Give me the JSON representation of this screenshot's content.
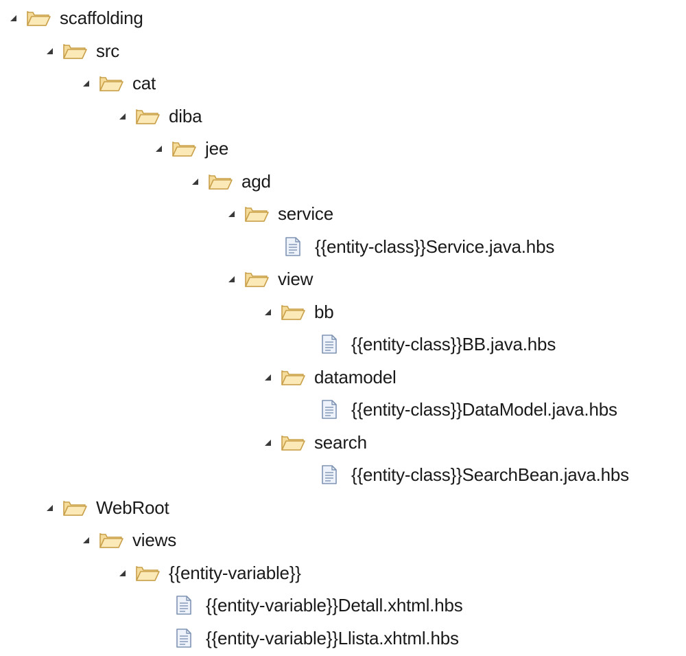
{
  "tree": {
    "nodes": [
      {
        "label": "scaffolding",
        "kind": "folder",
        "expanded": true,
        "depth": 0
      },
      {
        "label": "src",
        "kind": "folder",
        "expanded": true,
        "depth": 1
      },
      {
        "label": "cat",
        "kind": "folder",
        "expanded": true,
        "depth": 2
      },
      {
        "label": "diba",
        "kind": "folder",
        "expanded": true,
        "depth": 3
      },
      {
        "label": "jee",
        "kind": "folder",
        "expanded": true,
        "depth": 4
      },
      {
        "label": "agd",
        "kind": "folder",
        "expanded": true,
        "depth": 5
      },
      {
        "label": "service",
        "kind": "folder",
        "expanded": true,
        "depth": 6
      },
      {
        "label": "{{entity-class}}Service.java.hbs",
        "kind": "file",
        "depth": 7
      },
      {
        "label": "view",
        "kind": "folder",
        "expanded": true,
        "depth": 6
      },
      {
        "label": "bb",
        "kind": "folder",
        "expanded": true,
        "depth": 7
      },
      {
        "label": "{{entity-class}}BB.java.hbs",
        "kind": "file",
        "depth": 8
      },
      {
        "label": "datamodel",
        "kind": "folder",
        "expanded": true,
        "depth": 7
      },
      {
        "label": "{{entity-class}}DataModel.java.hbs",
        "kind": "file",
        "depth": 8
      },
      {
        "label": "search",
        "kind": "folder",
        "expanded": true,
        "depth": 7
      },
      {
        "label": "{{entity-class}}SearchBean.java.hbs",
        "kind": "file",
        "depth": 8
      },
      {
        "label": "WebRoot",
        "kind": "folder",
        "expanded": true,
        "depth": 1
      },
      {
        "label": "views",
        "kind": "folder",
        "expanded": true,
        "depth": 2
      },
      {
        "label": "{{entity-variable}}",
        "kind": "folder",
        "expanded": true,
        "depth": 3
      },
      {
        "label": "{{entity-variable}}Detall.xhtml.hbs",
        "kind": "file",
        "depth": 4
      },
      {
        "label": "{{entity-variable}}Llista.xhtml.hbs",
        "kind": "file",
        "depth": 4
      }
    ]
  },
  "colors": {
    "folder_fill": "#f6dc9a",
    "folder_stroke": "#c9a04a",
    "file_fill": "#eef3fb",
    "file_stroke": "#7f93b3",
    "arrow": "#3a3a3a",
    "text": "#1a1a1a"
  },
  "icons": {
    "folder": "open-folder-icon",
    "file": "text-file-icon",
    "expanded": "expanded-triangle-icon"
  }
}
